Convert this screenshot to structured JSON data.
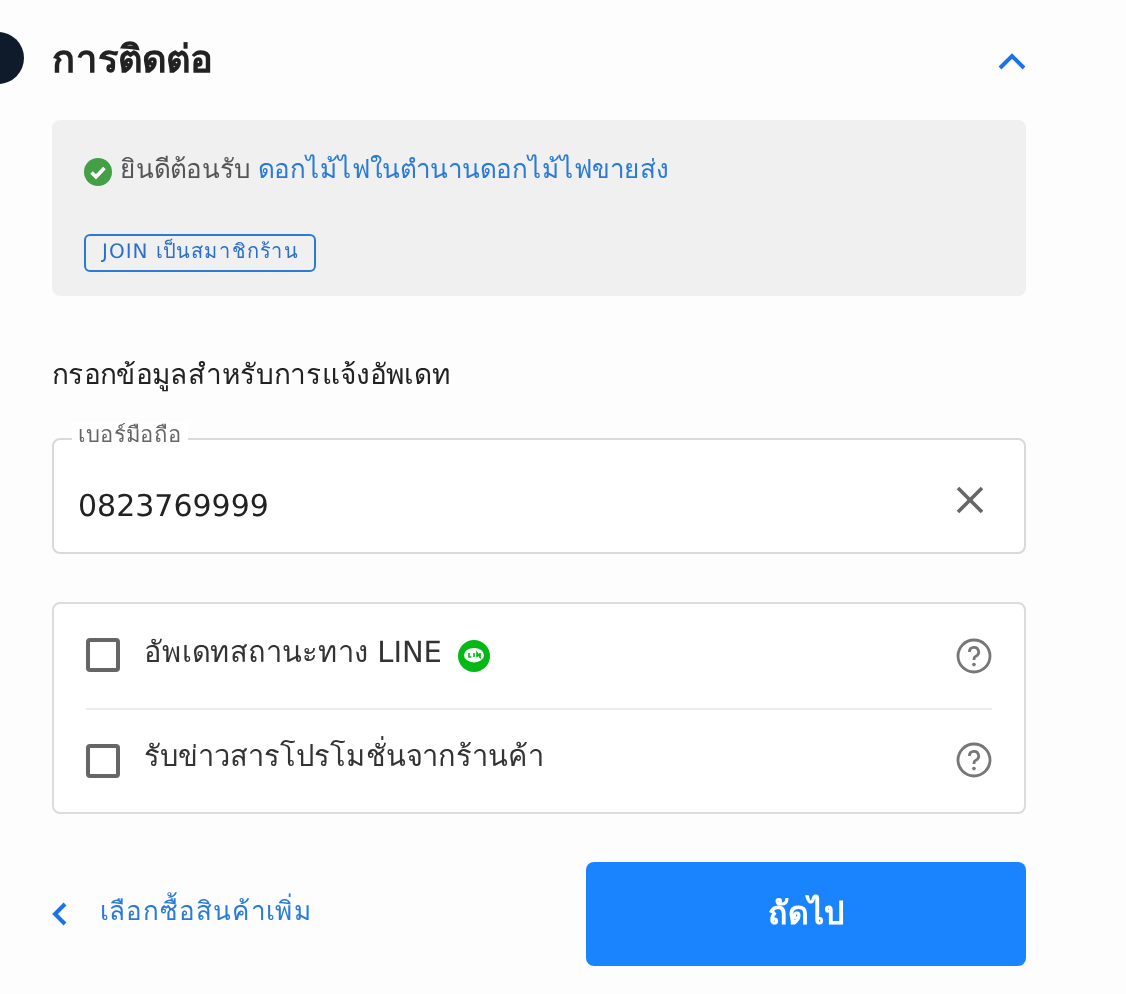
{
  "section": {
    "title": "การติดต่อ",
    "expanded": true
  },
  "welcome": {
    "greeting": "ยินดีต้อนรับ",
    "shop_link": "ดอกไม้ไฟในตำนานดอกไม้ไฟขายส่ง",
    "join_button": "JOIN เป็นสมาชิกร้าน"
  },
  "form_heading": "กรอกข้อมูลสำหรับการแจ้งอัพเดท",
  "phone_field": {
    "label": "เบอร์มือถือ",
    "value": "0823769999"
  },
  "options": [
    {
      "label": "อัพเดทสถานะทาง LINE",
      "checked": false,
      "kind": "line"
    },
    {
      "label": "รับข่าวสารโปรโมชั่นจากร้านค้า",
      "checked": false,
      "kind": "plain"
    }
  ],
  "back_link": "เลือกซื้อสินค้าเพิ่ม",
  "next_button": "ถัดไป"
}
